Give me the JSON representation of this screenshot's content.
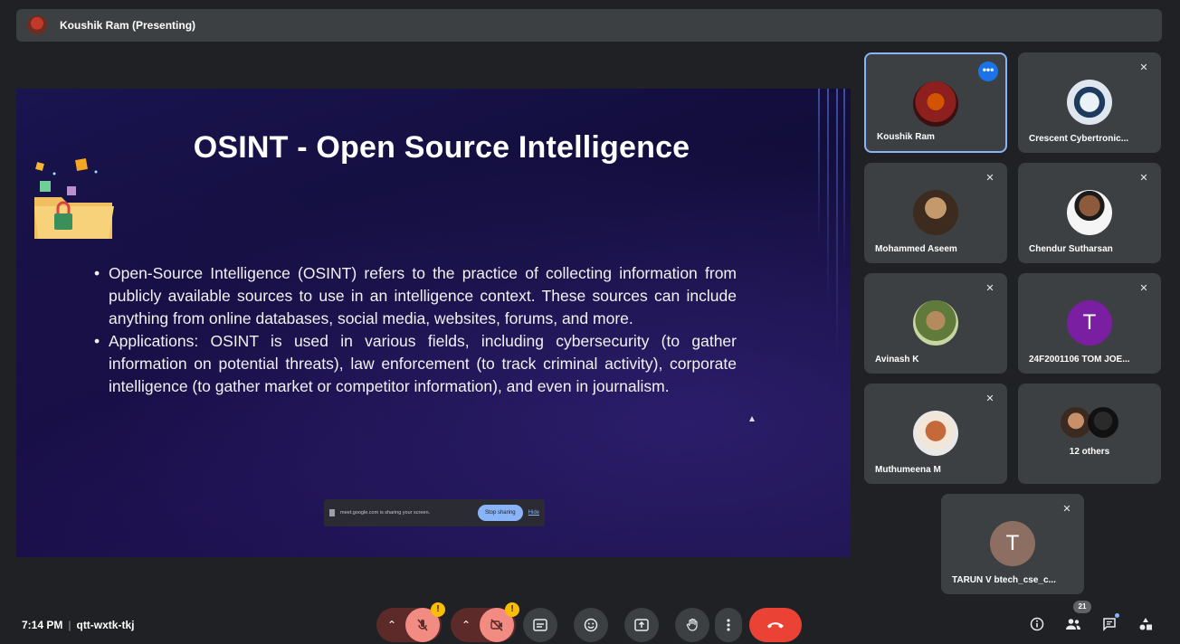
{
  "presenter_bar": {
    "name": "Koushik Ram (Presenting)"
  },
  "slide": {
    "title": "OSINT - Open Source Intelligence",
    "bullets": [
      "Open-Source Intelligence (OSINT) refers to the practice of collecting information from publicly available sources to use in an intelligence context. These sources can include anything from online databases, social media, websites, forums, and more.",
      "Applications: OSINT is used in various fields, including cybersecurity (to gather information on potential threats), law enforcement (to track criminal activity), corporate intelligence (to gather market or competitor information), and even in journalism."
    ],
    "share_notice": {
      "text": "meet.google.com is sharing your screen.",
      "stop_label": "Stop sharing",
      "hide_label": "Hide"
    }
  },
  "participants": [
    {
      "name": "Koushik Ram",
      "avatar": "photo",
      "active": true
    },
    {
      "name": "Crescent Cybertronic...",
      "avatar": "logo",
      "muted": true
    },
    {
      "name": "Mohammed Aseem",
      "avatar": "photo",
      "muted": true
    },
    {
      "name": "Chendur Sutharsan",
      "avatar": "photo",
      "muted": true
    },
    {
      "name": "Avinash K",
      "avatar": "photo",
      "muted": true
    },
    {
      "name": "24F2001106 TOM JOE...",
      "avatar_letter": "T",
      "avatar_color": "#7b1fa2",
      "muted": true
    },
    {
      "name": "Muthumeena M",
      "avatar": "photo",
      "muted": true
    },
    {
      "name": "12 others",
      "avatar": "group"
    },
    {
      "name": "TARUN V btech_cse_c...",
      "avatar_letter": "T",
      "avatar_color": "#8d6e63",
      "muted": true
    }
  ],
  "meeting": {
    "time": "7:14 PM",
    "code": "qtt-wxtk-tkj"
  },
  "controls": {
    "mic_warning": "!",
    "cam_warning": "!",
    "participant_count": "21"
  },
  "colors": {
    "accent": "#8ab4f8",
    "end_call": "#ea4335",
    "muted_red": "#f28b82",
    "tile_bg": "#3c4043",
    "page_bg": "#202124"
  }
}
